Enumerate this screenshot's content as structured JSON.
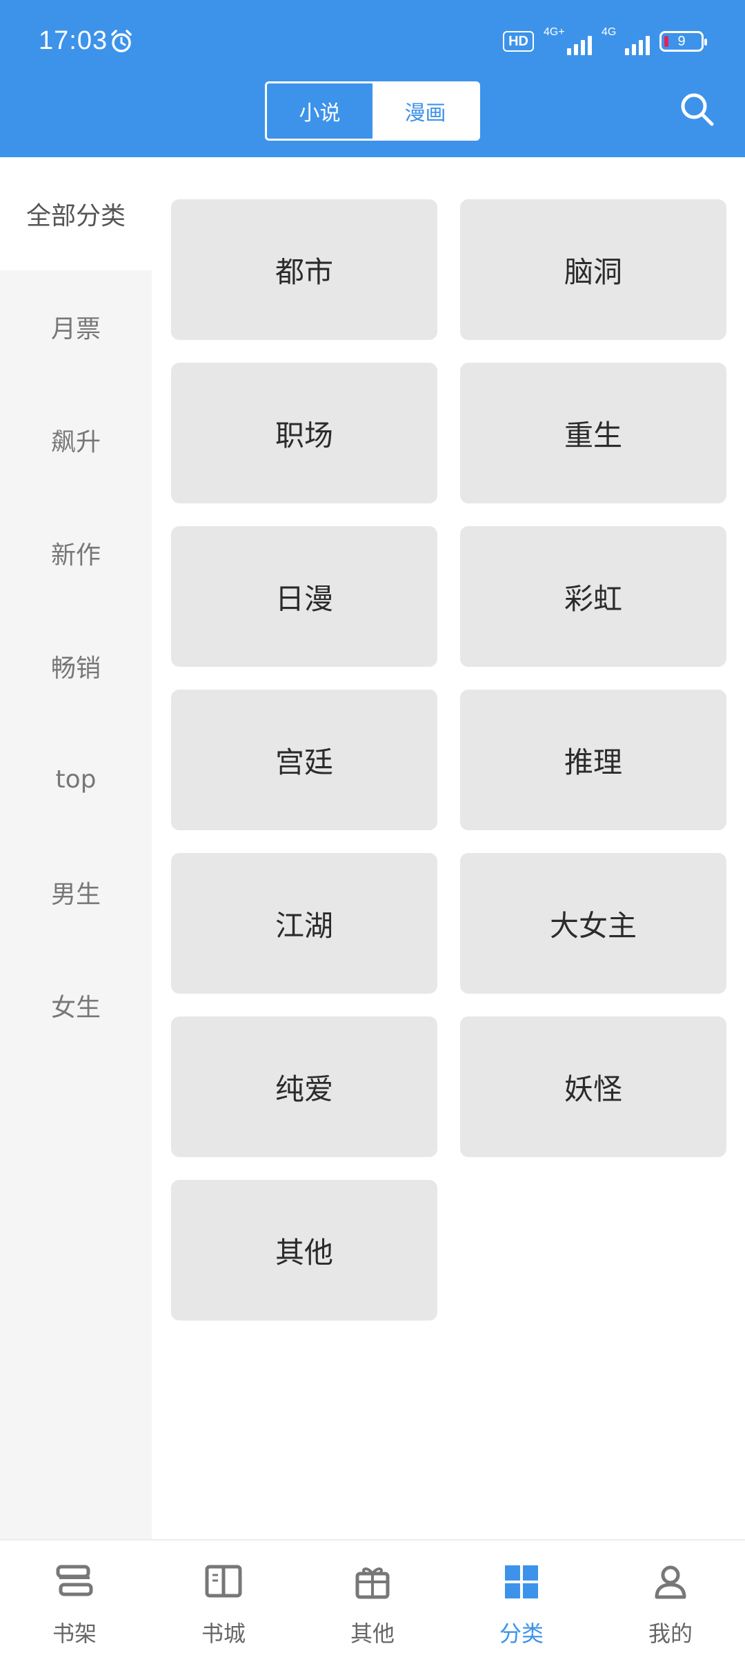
{
  "status_bar": {
    "time": "17:03",
    "hd_label": "HD",
    "network1_label": "4G+",
    "network2_label": "4G",
    "battery_level": "9",
    "colors": {
      "battery_low": "#e0245e"
    }
  },
  "header": {
    "segments": [
      {
        "label": "小说",
        "selected": true
      },
      {
        "label": "漫画",
        "selected": false
      }
    ],
    "search_icon": "search-icon"
  },
  "sidebar": {
    "items": [
      {
        "label": "全部分类",
        "selected": true
      },
      {
        "label": "月票",
        "selected": false
      },
      {
        "label": "飙升",
        "selected": false
      },
      {
        "label": "新作",
        "selected": false
      },
      {
        "label": "畅销",
        "selected": false
      },
      {
        "label": "top",
        "selected": false
      },
      {
        "label": "男生",
        "selected": false
      },
      {
        "label": "女生",
        "selected": false
      }
    ]
  },
  "categories": [
    "都市",
    "脑洞",
    "职场",
    "重生",
    "日漫",
    "彩虹",
    "宫廷",
    "推理",
    "江湖",
    "大女主",
    "纯爱",
    "妖怪",
    "其他"
  ],
  "tabbar": {
    "tabs": [
      {
        "label": "书架",
        "icon": "bookshelf-icon",
        "active": false
      },
      {
        "label": "书城",
        "icon": "book-open-icon",
        "active": false
      },
      {
        "label": "其他",
        "icon": "gift-icon",
        "active": false
      },
      {
        "label": "分类",
        "icon": "grid-icon",
        "active": true
      },
      {
        "label": "我的",
        "icon": "user-icon",
        "active": false
      }
    ]
  },
  "colors": {
    "primary": "#3d93ea",
    "tag_bg": "#e7e7e7",
    "sidebar_bg": "#f5f5f5"
  }
}
